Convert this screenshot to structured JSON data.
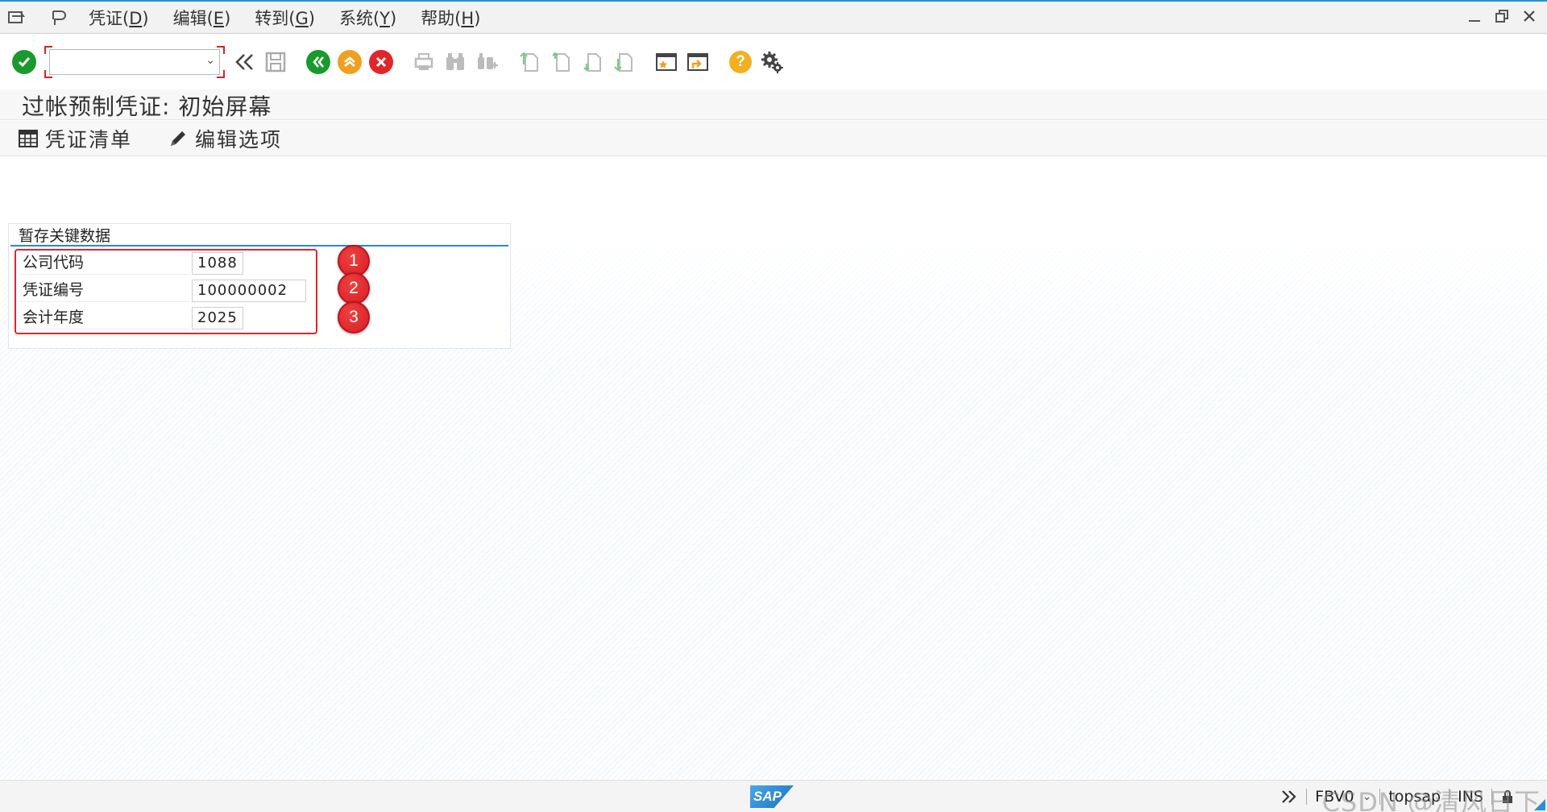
{
  "menubar": {
    "items": [
      {
        "label": "凭证(",
        "key": "D",
        "tail": ")"
      },
      {
        "label": "编辑(",
        "key": "E",
        "tail": ")"
      },
      {
        "label": "转到(",
        "key": "G",
        "tail": ")"
      },
      {
        "label": "系统(",
        "key": "Y",
        "tail": ")"
      },
      {
        "label": "帮助(",
        "key": "H",
        "tail": ")"
      }
    ]
  },
  "toolbar": {
    "command_value": "",
    "icons": [
      "enter-icon",
      "back-double-icon",
      "save-icon",
      "back-icon",
      "exit-icon",
      "cancel-icon",
      "print-icon",
      "find-icon",
      "find-next-icon",
      "first-page-icon",
      "previous-page-icon",
      "next-page-icon",
      "last-page-icon",
      "create-session-icon",
      "shortcut-icon",
      "help-icon",
      "settings-icon"
    ]
  },
  "title": "过帐预制凭证: 初始屏幕",
  "app_toolbar": {
    "doc_list_label": "凭证清单",
    "edit_options_label": "编辑选项"
  },
  "group": {
    "title": "暂存关键数据",
    "fields": [
      {
        "label": "公司代码",
        "value": "1088",
        "badge": "1"
      },
      {
        "label": "凭证编号",
        "value": "100000002",
        "badge": "2"
      },
      {
        "label": "会计年度",
        "value": "2025",
        "badge": "3"
      }
    ]
  },
  "status": {
    "logo": "SAP",
    "transaction": "FBV0",
    "server": "topsap",
    "mode": "INS",
    "watermark": "CSDN @清风日下"
  },
  "colors": {
    "accent": "#2a8fd8",
    "highlight_red": "#e0262a",
    "enter_green": "#1a9a2c",
    "back_green": "#1a9a2c",
    "exit_orange": "#f0a020",
    "cancel_red": "#e0262a",
    "help_yellow": "#f0b020"
  }
}
